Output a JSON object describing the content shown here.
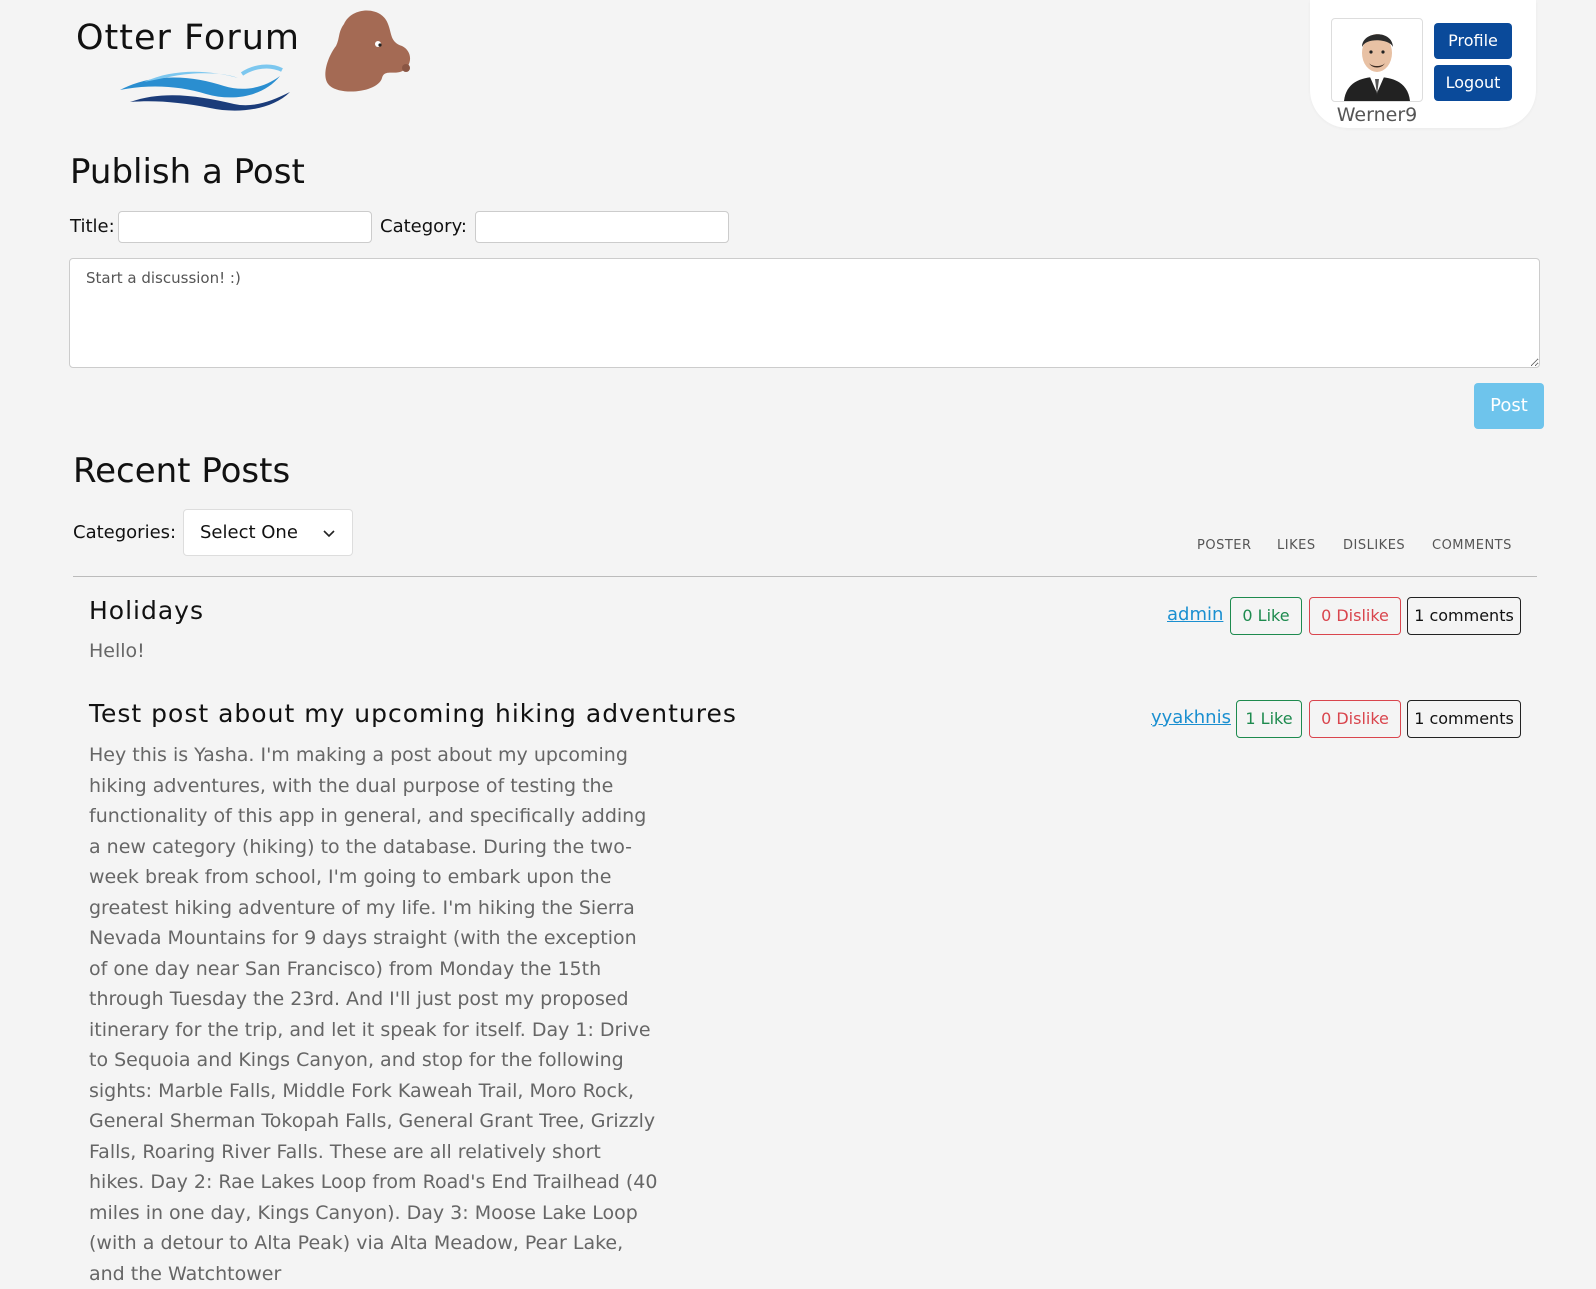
{
  "brand": {
    "name": "Otter Forum"
  },
  "user": {
    "username": "Werner9",
    "profile_label": "Profile",
    "logout_label": "Logout"
  },
  "publish": {
    "heading": "Publish a Post",
    "title_label": "Title:",
    "category_label": "Category:",
    "title_value": "",
    "category_value": "",
    "body_placeholder": "Start a discussion! :)",
    "post_label": "Post"
  },
  "recent": {
    "heading": "Recent Posts",
    "categories_label": "Categories:",
    "select_value": "Select One",
    "columns": [
      "POSTER",
      "LIKES",
      "DISLIKES",
      "COMMENTS"
    ]
  },
  "posts": [
    {
      "title": "Holidays",
      "body": "Hello!",
      "poster": "admin",
      "likes": "0 Like",
      "dislikes": "0 Dislike",
      "comments": "1 comments"
    },
    {
      "title": "Test post about my upcoming hiking adventures",
      "body": "Hey this is Yasha. I'm making a post about my upcoming hiking adventures, with the dual purpose of testing the functionality of this app in general, and specifically adding a new category (hiking) to the database. During the two-week break from school, I'm going to embark upon the greatest hiking adventure of my life. I'm hiking the Sierra Nevada Mountains for 9 days straight (with the exception of one day near San Francisco) from Monday the 15th through Tuesday the 23rd. And I'll just post my proposed itinerary for the trip, and let it speak for itself. Day 1: Drive to Sequoia and Kings Canyon, and stop for the following sights: Marble Falls, Middle Fork Kaweah Trail, Moro Rock, General Sherman Tokopah Falls, General Grant Tree, Grizzly Falls, Roaring River Falls. These are all relatively short hikes. Day 2: Rae Lakes Loop from Road's End Trailhead (40 miles in one day, Kings Canyon). Day 3: Moose Lake Loop (with a detour to Alta Peak) via Alta Meadow, Pear Lake, and the Watchtower",
      "poster": "yyakhnis",
      "likes": "1 Like",
      "dislikes": "0 Dislike",
      "comments": "1 comments"
    }
  ]
}
